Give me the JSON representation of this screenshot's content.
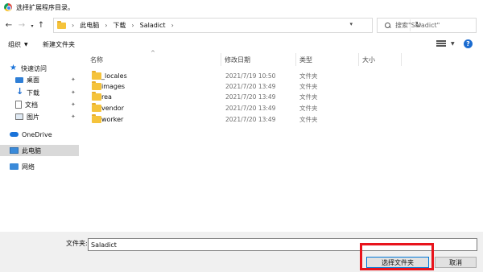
{
  "window": {
    "title": "选择扩展程序目录。"
  },
  "address": {
    "breadcrumbs": [
      "此电脑",
      "下载",
      "Saladict"
    ],
    "search_placeholder": "搜索\"Saladict\""
  },
  "toolbar": {
    "organize_label": "组织",
    "new_folder_label": "新建文件夹"
  },
  "sidebar": {
    "quick_access": "快速访问",
    "items": [
      {
        "label": "桌面",
        "icon": "desktop-icon",
        "pinned": true
      },
      {
        "label": "下载",
        "icon": "download-icon",
        "pinned": true
      },
      {
        "label": "文档",
        "icon": "document-icon",
        "pinned": true
      },
      {
        "label": "图片",
        "icon": "picture-icon",
        "pinned": true
      }
    ],
    "onedrive": "OneDrive",
    "this_pc": "此电脑",
    "network": "网络"
  },
  "columns": {
    "name": "名称",
    "modified": "修改日期",
    "type": "类型",
    "size": "大小"
  },
  "files": [
    {
      "name": "_locales",
      "modified": "2021/7/19 10:50",
      "type": "文件夹"
    },
    {
      "name": "images",
      "modified": "2021/7/20 13:49",
      "type": "文件夹"
    },
    {
      "name": "rea",
      "modified": "2021/7/20 13:49",
      "type": "文件夹"
    },
    {
      "name": "vendor",
      "modified": "2021/7/20 13:49",
      "type": "文件夹"
    },
    {
      "name": "worker",
      "modified": "2021/7/20 13:49",
      "type": "文件夹"
    }
  ],
  "footer": {
    "folder_label": "文件夹:",
    "folder_value": "Saladict",
    "select_button": "选择文件夹",
    "cancel_button": "取消"
  },
  "colors": {
    "highlight": "#e8141c",
    "accent": "#0078d7",
    "folder": "#f5c33b"
  }
}
